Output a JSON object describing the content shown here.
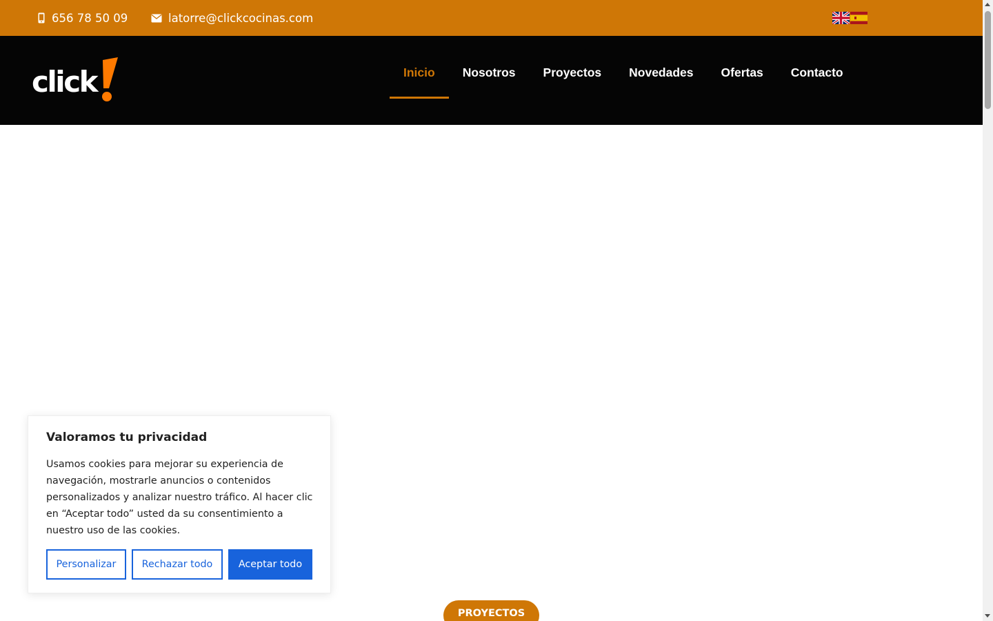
{
  "topbar": {
    "phone": "656 78 50 09",
    "email": "latorre@clickcocinas.com",
    "phone_icon": "mobile-phone-icon",
    "email_icon": "envelope-icon",
    "languages": [
      "English",
      "Español"
    ]
  },
  "header": {
    "logo_text": "click!",
    "nav": [
      {
        "label": "Inicio",
        "active": true
      },
      {
        "label": "Nosotros",
        "active": false
      },
      {
        "label": "Proyectos",
        "active": false
      },
      {
        "label": "Novedades",
        "active": false
      },
      {
        "label": "Ofertas",
        "active": false
      },
      {
        "label": "Contacto",
        "active": false
      }
    ]
  },
  "cookie": {
    "title": "Valoramos tu privacidad",
    "text": "Usamos cookies para mejorar su experiencia de navegación, mostrarle anuncios o contenidos personalizados y analizar nuestro tráfico. Al hacer clic en “Aceptar todo” usted da su consentimiento a nuestro uso de las cookies.",
    "customize_label": "Personalizar",
    "reject_label": "Rechazar todo",
    "accept_label": "Aceptar todo"
  },
  "main": {
    "projects_button": "PROYECTOS"
  },
  "colors": {
    "brand_orange": "#cf7706",
    "header_black": "#050505",
    "cookie_blue": "#1863dc"
  }
}
